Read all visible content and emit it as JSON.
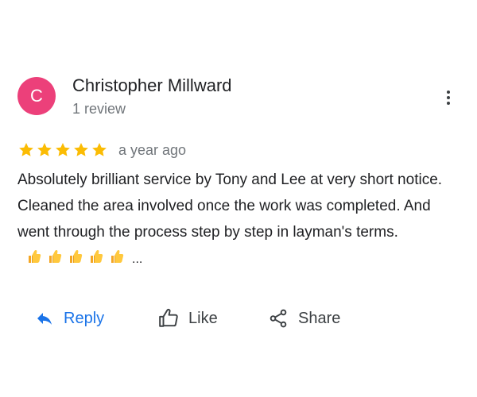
{
  "reviewer": {
    "initial": "C",
    "name": "Christopher Millward",
    "review_count": "1 review",
    "avatar_color": "#ec407a"
  },
  "review": {
    "rating": 5,
    "max_rating": 5,
    "time": "a year ago",
    "text": "Absolutely brilliant service by Tony and Lee at very short notice. Cleaned the area involved once the work was completed. And went through the process step by step in layman's terms.",
    "emojis": [
      "thumbs-up-emoji",
      "thumbs-up-emoji",
      "thumbs-up-emoji",
      "thumbs-up-emoji",
      "thumbs-up-emoji"
    ],
    "truncation": "..."
  },
  "actions": {
    "reply_label": "Reply",
    "like_label": "Like",
    "share_label": "Share"
  },
  "colors": {
    "star": "#fbbc04",
    "reply": "#1a73e8",
    "text": "#202124",
    "secondary": "#70757a",
    "action_text": "#3c4043"
  },
  "icons": {
    "menu": "more-vert-icon",
    "reply": "reply-arrow-icon",
    "like": "thumb-up-outline-icon",
    "share": "share-icon"
  }
}
